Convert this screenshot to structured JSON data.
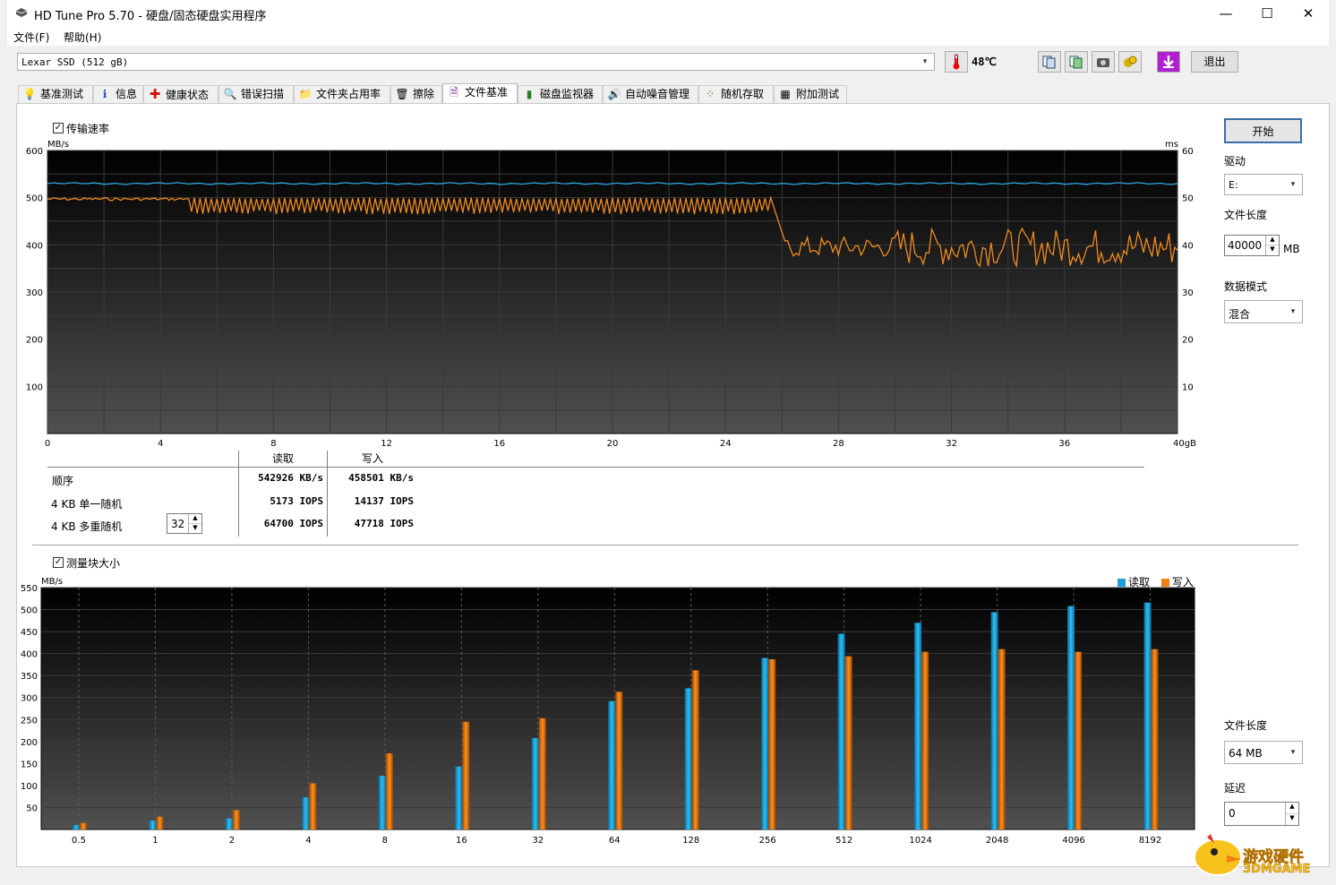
{
  "window": {
    "title": "HD Tune Pro 5.70 - 硬盘/固态硬盘实用程序",
    "minimize": "—",
    "maximize": "☐",
    "close": "✕"
  },
  "menu": [
    "文件(F)",
    "帮助(H)"
  ],
  "toolbar": {
    "drive": "Lexar SSD (512 gB)",
    "temperature": "48℃",
    "exit_label": "退出",
    "icons": [
      "copy-info-icon",
      "copy-screen-icon",
      "screenshot-icon",
      "options-icon",
      "save-down-icon"
    ]
  },
  "tabs": [
    {
      "label": "基准测试",
      "icon": "💡"
    },
    {
      "label": "信息",
      "icon": "ℹ"
    },
    {
      "label": "健康状态",
      "icon": "✚"
    },
    {
      "label": "错误扫描",
      "icon": "🔍"
    },
    {
      "label": "文件夹占用率",
      "icon": "📁"
    },
    {
      "label": "擦除",
      "icon": "🗑"
    },
    {
      "label": "文件基准",
      "icon": "🗎"
    },
    {
      "label": "磁盘监视器",
      "icon": "▮"
    },
    {
      "label": "自动噪音管理",
      "icon": "🔊"
    },
    {
      "label": "随机存取",
      "icon": "⁘"
    },
    {
      "label": "附加测试",
      "icon": "▦"
    }
  ],
  "active_tab": "文件基准",
  "transfer": {
    "checkbox_label": "传输速率",
    "checked": true,
    "y_left_unit": "MB/s",
    "y_right_unit": "ms"
  },
  "results": {
    "col_read": "读取",
    "col_write": "写入",
    "rows": [
      {
        "label": "顺序",
        "read": "542926 KB/s",
        "write": "458501 KB/s"
      },
      {
        "label": "4 KB 单一随机",
        "read": "5173 IOPS",
        "write": "14137 IOPS"
      },
      {
        "label": "4 KB 多重随机",
        "read": "64700 IOPS",
        "write": "47718 IOPS"
      }
    ],
    "queue_depth": "32"
  },
  "block": {
    "checkbox_label": "测量块大小",
    "checked": true,
    "unit": "MB/s",
    "legend_read": "读取",
    "legend_write": "写入"
  },
  "side": {
    "start_label": "开始",
    "drive_label": "驱动",
    "drive_value": "E:",
    "file_length_label": "文件长度",
    "file_length_value": "40000",
    "file_length_unit": "MB",
    "data_mode_label": "数据模式",
    "data_mode_value": "混合",
    "block_file_length_label": "文件长度",
    "block_file_length_value": "64 MB",
    "delay_label": "延迟",
    "delay_value": "0"
  },
  "watermark": {
    "text1": "游戏硬件",
    "text2": "3DMGAME"
  },
  "colors": {
    "read": "#1ea0d8",
    "write": "#f07f10",
    "line_read": "#2fa8e0",
    "line_write": "#f08a20"
  },
  "chart_data": [
    {
      "type": "line",
      "x_ticks": [
        "0",
        "4",
        "8",
        "12",
        "16",
        "20",
        "24",
        "28",
        "32",
        "36",
        "40gB"
      ],
      "xlim": [
        0,
        40
      ],
      "y_left_ticks": [
        "100",
        "200",
        "300",
        "400",
        "500",
        "600"
      ],
      "y_right_ticks": [
        "10",
        "20",
        "30",
        "40",
        "50",
        "60"
      ],
      "ylim": [
        0,
        600
      ],
      "ylabel": "MB/s",
      "y2label": "ms",
      "grid": true,
      "series": [
        {
          "color": "#2fa8e0",
          "description": "flat ~530 MB/s",
          "x": [
            0,
            40
          ],
          "y": [
            530,
            530
          ]
        },
        {
          "color": "#f08a20",
          "x": [
            0,
            5,
            25.8,
            26.2,
            40
          ],
          "y": [
            500,
            500,
            500,
            395,
            395
          ]
        }
      ]
    },
    {
      "type": "bar",
      "categories": [
        "0.5",
        "1",
        "2",
        "4",
        "8",
        "16",
        "32",
        "64",
        "128",
        "256",
        "512",
        "1024",
        "2048",
        "4096",
        "8192"
      ],
      "ylim": [
        0,
        550
      ],
      "y_ticks": [
        "50",
        "100",
        "150",
        "200",
        "250",
        "300",
        "350",
        "400",
        "450",
        "500",
        "550"
      ],
      "ylabel": "MB/s",
      "grid": true,
      "legend": "top-right",
      "series": [
        {
          "name": "读取",
          "values": [
            10,
            20,
            25,
            73,
            122,
            143,
            208,
            292,
            321,
            390,
            445,
            470,
            494,
            508,
            516
          ]
        },
        {
          "name": "写入",
          "values": [
            15,
            29,
            44,
            105,
            173,
            245,
            253,
            313,
            362,
            387,
            394,
            404,
            410,
            404,
            410
          ]
        }
      ]
    }
  ]
}
